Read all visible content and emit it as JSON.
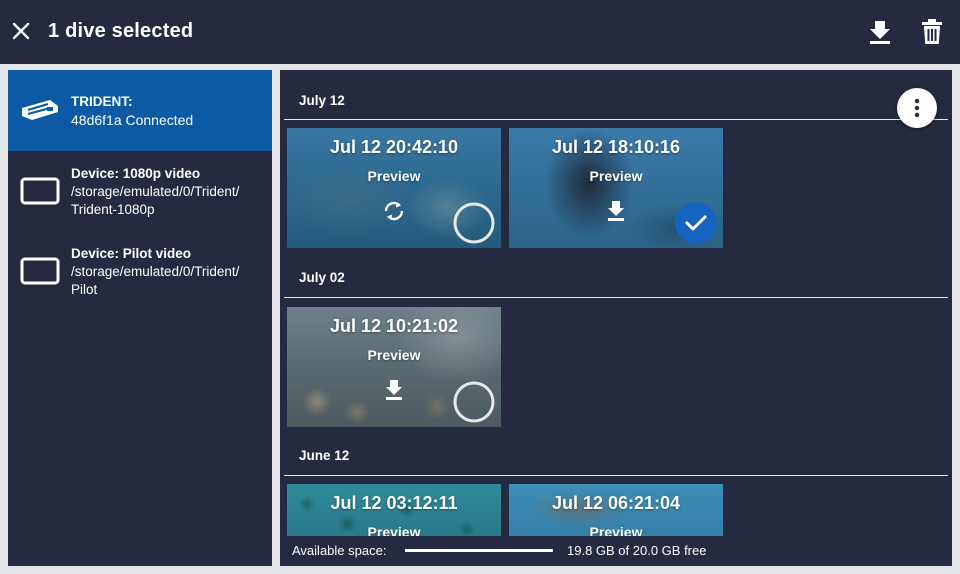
{
  "appbar": {
    "title": "1 dive selected",
    "icons": {
      "close": "close-icon",
      "download": "download-icon",
      "delete": "trash-icon"
    }
  },
  "sidebar": {
    "items": [
      {
        "title": "TRIDENT:",
        "subtitle": "48d6f1a Connected",
        "icon": "trident-drone-icon",
        "active": true
      },
      {
        "title": "Device: 1080p video",
        "path_line1": "/storage/emulated/0/Trident/",
        "path_line2": "Trident-1080p",
        "icon": "storage-rectangle-icon"
      },
      {
        "title": "Device: Pilot video",
        "path_line1": "/storage/emulated/0/Trident/",
        "path_line2": "Pilot",
        "icon": "storage-rectangle-icon"
      }
    ]
  },
  "main": {
    "sections": [
      {
        "label": "July 12",
        "dives": [
          {
            "time": "Jul 12 20:42:10",
            "preview": "Preview",
            "status_icon": "sync-icon",
            "selected": false
          },
          {
            "time": "Jul 12 18:10:16",
            "preview": "Preview",
            "status_icon": "download-icon",
            "selected": true
          }
        ]
      },
      {
        "label": "July 02",
        "dives": [
          {
            "time": "Jul 12 10:21:02",
            "preview": "Preview",
            "status_icon": "download-icon",
            "selected": false
          }
        ]
      },
      {
        "label": "June 12",
        "dives": [
          {
            "time": "Jul 12 03:12:11",
            "preview": "Preview"
          },
          {
            "time": "Jul 12 06:21:04",
            "preview": "Preview"
          }
        ]
      }
    ]
  },
  "footer": {
    "label": "Available space:",
    "free_text": "19.8 GB of 20.0 GB free",
    "free_fraction": 0.99
  },
  "colors": {
    "panel": "#252a40",
    "active": "#0b5aa3",
    "selected_check": "#1565c0"
  }
}
